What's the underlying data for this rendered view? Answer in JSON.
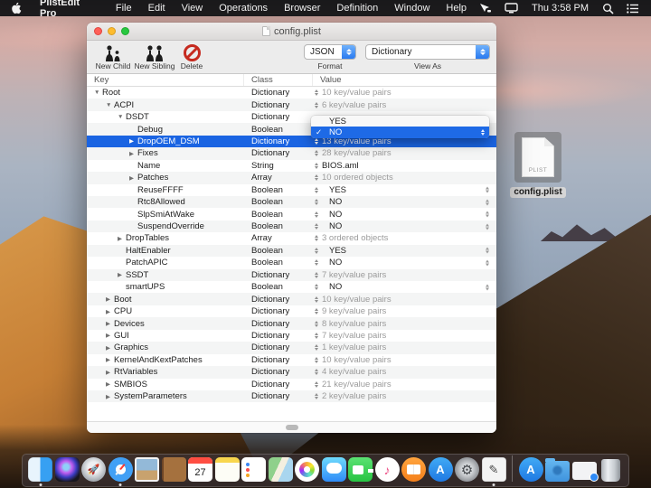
{
  "menu_bar": {
    "app_name": "PlistEdit Pro",
    "menus": [
      "File",
      "Edit",
      "View",
      "Operations",
      "Browser",
      "Definition",
      "Window",
      "Help"
    ],
    "status_icons": [
      "pointer-tool-icon",
      "displays-icon"
    ],
    "time": "Thu 3:58 PM"
  },
  "window": {
    "title": "config.plist",
    "toolbar": {
      "new_child_label": "New Child",
      "new_sibling_label": "New Sibling",
      "delete_label": "Delete",
      "format_value": "JSON",
      "format_label": "Format",
      "view_as_value": "Dictionary",
      "view_as_label": "View As"
    },
    "table": {
      "columns": [
        "Key",
        "Class",
        "Value"
      ],
      "rows": [
        {
          "key": "Root",
          "level": 0,
          "disc": "open",
          "cls": "Dictionary",
          "val": "10 key/value pairs",
          "muted": true,
          "editable": false,
          "selected": false,
          "hidden": false
        },
        {
          "key": "ACPI",
          "level": 1,
          "disc": "open",
          "cls": "Dictionary",
          "val": "6 key/value pairs",
          "muted": true,
          "editable": false,
          "selected": false,
          "hidden": false
        },
        {
          "key": "DSDT",
          "level": 2,
          "disc": "open",
          "cls": "Dictionary",
          "val": "",
          "muted": true,
          "editable": false,
          "selected": false,
          "hidden": true
        },
        {
          "key": "Debug",
          "level": 3,
          "disc": null,
          "cls": "Boolean",
          "val": "",
          "muted": false,
          "editable": false,
          "selected": false,
          "hidden": true
        },
        {
          "key": "DropOEM_DSM",
          "level": 3,
          "disc": "closed",
          "cls": "Dictionary",
          "val": "13 key/value pairs",
          "muted": true,
          "editable": false,
          "selected": true,
          "hidden": false
        },
        {
          "key": "Fixes",
          "level": 3,
          "disc": "closed",
          "cls": "Dictionary",
          "val": "28 key/value pairs",
          "muted": true,
          "editable": false,
          "selected": false,
          "hidden": false
        },
        {
          "key": "Name",
          "level": 3,
          "disc": null,
          "cls": "String",
          "val": "BIOS.aml",
          "muted": false,
          "editable": false,
          "selected": false,
          "hidden": false
        },
        {
          "key": "Patches",
          "level": 3,
          "disc": "closed",
          "cls": "Array",
          "val": "10 ordered objects",
          "muted": true,
          "editable": false,
          "selected": false,
          "hidden": false
        },
        {
          "key": "ReuseFFFF",
          "level": 3,
          "disc": null,
          "cls": "Boolean",
          "val": "YES",
          "muted": false,
          "editable": true,
          "selected": false,
          "hidden": false
        },
        {
          "key": "Rtc8Allowed",
          "level": 3,
          "disc": null,
          "cls": "Boolean",
          "val": "NO",
          "muted": false,
          "editable": true,
          "selected": false,
          "hidden": false
        },
        {
          "key": "SlpSmiAtWake",
          "level": 3,
          "disc": null,
          "cls": "Boolean",
          "val": "NO",
          "muted": false,
          "editable": true,
          "selected": false,
          "hidden": false
        },
        {
          "key": "SuspendOverride",
          "level": 3,
          "disc": null,
          "cls": "Boolean",
          "val": "NO",
          "muted": false,
          "editable": true,
          "selected": false,
          "hidden": false
        },
        {
          "key": "DropTables",
          "level": 2,
          "disc": "closed",
          "cls": "Array",
          "val": "3 ordered objects",
          "muted": true,
          "editable": false,
          "selected": false,
          "hidden": false
        },
        {
          "key": "HaltEnabler",
          "level": 2,
          "disc": null,
          "cls": "Boolean",
          "val": "YES",
          "muted": false,
          "editable": true,
          "selected": false,
          "hidden": false
        },
        {
          "key": "PatchAPIC",
          "level": 2,
          "disc": null,
          "cls": "Boolean",
          "val": "NO",
          "muted": false,
          "editable": true,
          "selected": false,
          "hidden": false
        },
        {
          "key": "SSDT",
          "level": 2,
          "disc": "closed",
          "cls": "Dictionary",
          "val": "7 key/value pairs",
          "muted": true,
          "editable": false,
          "selected": false,
          "hidden": false
        },
        {
          "key": "smartUPS",
          "level": 2,
          "disc": null,
          "cls": "Boolean",
          "val": "NO",
          "muted": false,
          "editable": true,
          "selected": false,
          "hidden": false
        },
        {
          "key": "Boot",
          "level": 1,
          "disc": "closed",
          "cls": "Dictionary",
          "val": "10 key/value pairs",
          "muted": true,
          "editable": false,
          "selected": false,
          "hidden": false
        },
        {
          "key": "CPU",
          "level": 1,
          "disc": "closed",
          "cls": "Dictionary",
          "val": "9 key/value pairs",
          "muted": true,
          "editable": false,
          "selected": false,
          "hidden": false
        },
        {
          "key": "Devices",
          "level": 1,
          "disc": "closed",
          "cls": "Dictionary",
          "val": "8 key/value pairs",
          "muted": true,
          "editable": false,
          "selected": false,
          "hidden": false
        },
        {
          "key": "GUI",
          "level": 1,
          "disc": "closed",
          "cls": "Dictionary",
          "val": "7 key/value pairs",
          "muted": true,
          "editable": false,
          "selected": false,
          "hidden": false
        },
        {
          "key": "Graphics",
          "level": 1,
          "disc": "closed",
          "cls": "Dictionary",
          "val": "1 key/value pairs",
          "muted": true,
          "editable": false,
          "selected": false,
          "hidden": false
        },
        {
          "key": "KernelAndKextPatches",
          "level": 1,
          "disc": "closed",
          "cls": "Dictionary",
          "val": "10 key/value pairs",
          "muted": true,
          "editable": false,
          "selected": false,
          "hidden": false
        },
        {
          "key": "RtVariables",
          "level": 1,
          "disc": "closed",
          "cls": "Dictionary",
          "val": "4 key/value pairs",
          "muted": true,
          "editable": false,
          "selected": false,
          "hidden": false
        },
        {
          "key": "SMBIOS",
          "level": 1,
          "disc": "closed",
          "cls": "Dictionary",
          "val": "21 key/value pairs",
          "muted": true,
          "editable": false,
          "selected": false,
          "hidden": false
        },
        {
          "key": "SystemParameters",
          "level": 1,
          "disc": "closed",
          "cls": "Dictionary",
          "val": "2 key/value pairs",
          "muted": true,
          "editable": false,
          "selected": false,
          "hidden": false
        }
      ]
    },
    "popup": {
      "options": [
        {
          "label": "YES",
          "checked": false
        },
        {
          "label": "NO",
          "checked": true
        }
      ]
    }
  },
  "desktop_file": {
    "label": "config.plist",
    "type_text": "PLIST"
  },
  "dock": {
    "calendar_day": "27",
    "items": [
      {
        "name": "finder",
        "css": "dk-finder",
        "glyph": "",
        "running": true
      },
      {
        "name": "siri",
        "css": "dk-siri",
        "glyph": "",
        "running": false
      },
      {
        "name": "launchpad",
        "css": "dk-launchpad",
        "glyph": "🚀",
        "running": false
      },
      {
        "name": "safari",
        "css": "dk-safari",
        "glyph": "",
        "running": true
      },
      {
        "name": "preview",
        "css": "dk-preview",
        "glyph": "",
        "running": false
      },
      {
        "name": "contacts",
        "css": "dk-contacts",
        "glyph": "",
        "running": false
      },
      {
        "name": "calendar",
        "css": "dk-calendar",
        "glyph": "",
        "running": false
      },
      {
        "name": "notes",
        "css": "dk-notes",
        "glyph": "",
        "running": false
      },
      {
        "name": "reminders",
        "css": "dk-reminders",
        "glyph": "",
        "running": false
      },
      {
        "name": "maps",
        "css": "dk-maps",
        "glyph": "",
        "running": false
      },
      {
        "name": "photos",
        "css": "dk-photos",
        "glyph": "",
        "running": false
      },
      {
        "name": "messages",
        "css": "dk-messages",
        "glyph": "",
        "running": false
      },
      {
        "name": "facetime",
        "css": "dk-facetime",
        "glyph": "",
        "running": false
      },
      {
        "name": "itunes",
        "css": "dk-itunes",
        "glyph": "♪",
        "running": false
      },
      {
        "name": "books",
        "css": "dk-books",
        "glyph": "",
        "running": false
      },
      {
        "name": "app-store",
        "css": "dk-appstore",
        "glyph": "A",
        "running": false
      },
      {
        "name": "system-preferences",
        "css": "dk-sysprefs",
        "glyph": "⚙",
        "running": false
      },
      {
        "name": "plistedit-pro",
        "css": "dk-plistedit",
        "glyph": "✎",
        "running": true
      },
      {
        "name": "separator",
        "css": "dsep",
        "glyph": "",
        "running": false
      },
      {
        "name": "applications-folder",
        "css": "dk-appstore",
        "glyph": "A",
        "running": false
      },
      {
        "name": "downloads-folder",
        "css": "dk-folder",
        "glyph": "",
        "running": false
      },
      {
        "name": "minimized-window",
        "css": "dk-minwin",
        "glyph": "",
        "running": false
      },
      {
        "name": "trash",
        "css": "dk-trash",
        "glyph": "",
        "running": false
      }
    ]
  },
  "colors": {
    "selection_blue": "#1a64e2",
    "popup_blue": "#1e6ae6",
    "stepper_blue": "#2a7af0",
    "muted_text": "#9b9b9b",
    "row_stripe": "#f4f5f5",
    "menubar_bg": "#171719"
  }
}
